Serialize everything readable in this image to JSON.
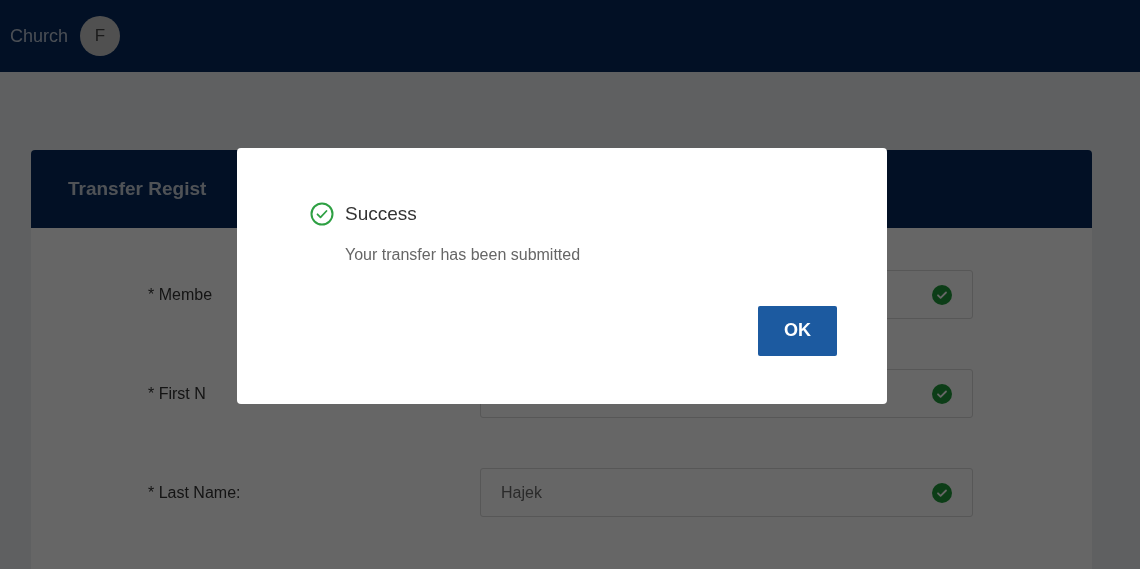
{
  "header": {
    "brand": "Church",
    "avatar": "F"
  },
  "card": {
    "title": "Transfer Regist",
    "fields": [
      {
        "label": "* Membe",
        "valid": true
      },
      {
        "label": "* First N",
        "valid": true
      },
      {
        "label": "* Last Name:",
        "value": "Hajek",
        "valid": true
      }
    ]
  },
  "dialog": {
    "kind": "success",
    "title": "Success",
    "message": "Your transfer has been submitted",
    "button": "OK"
  }
}
